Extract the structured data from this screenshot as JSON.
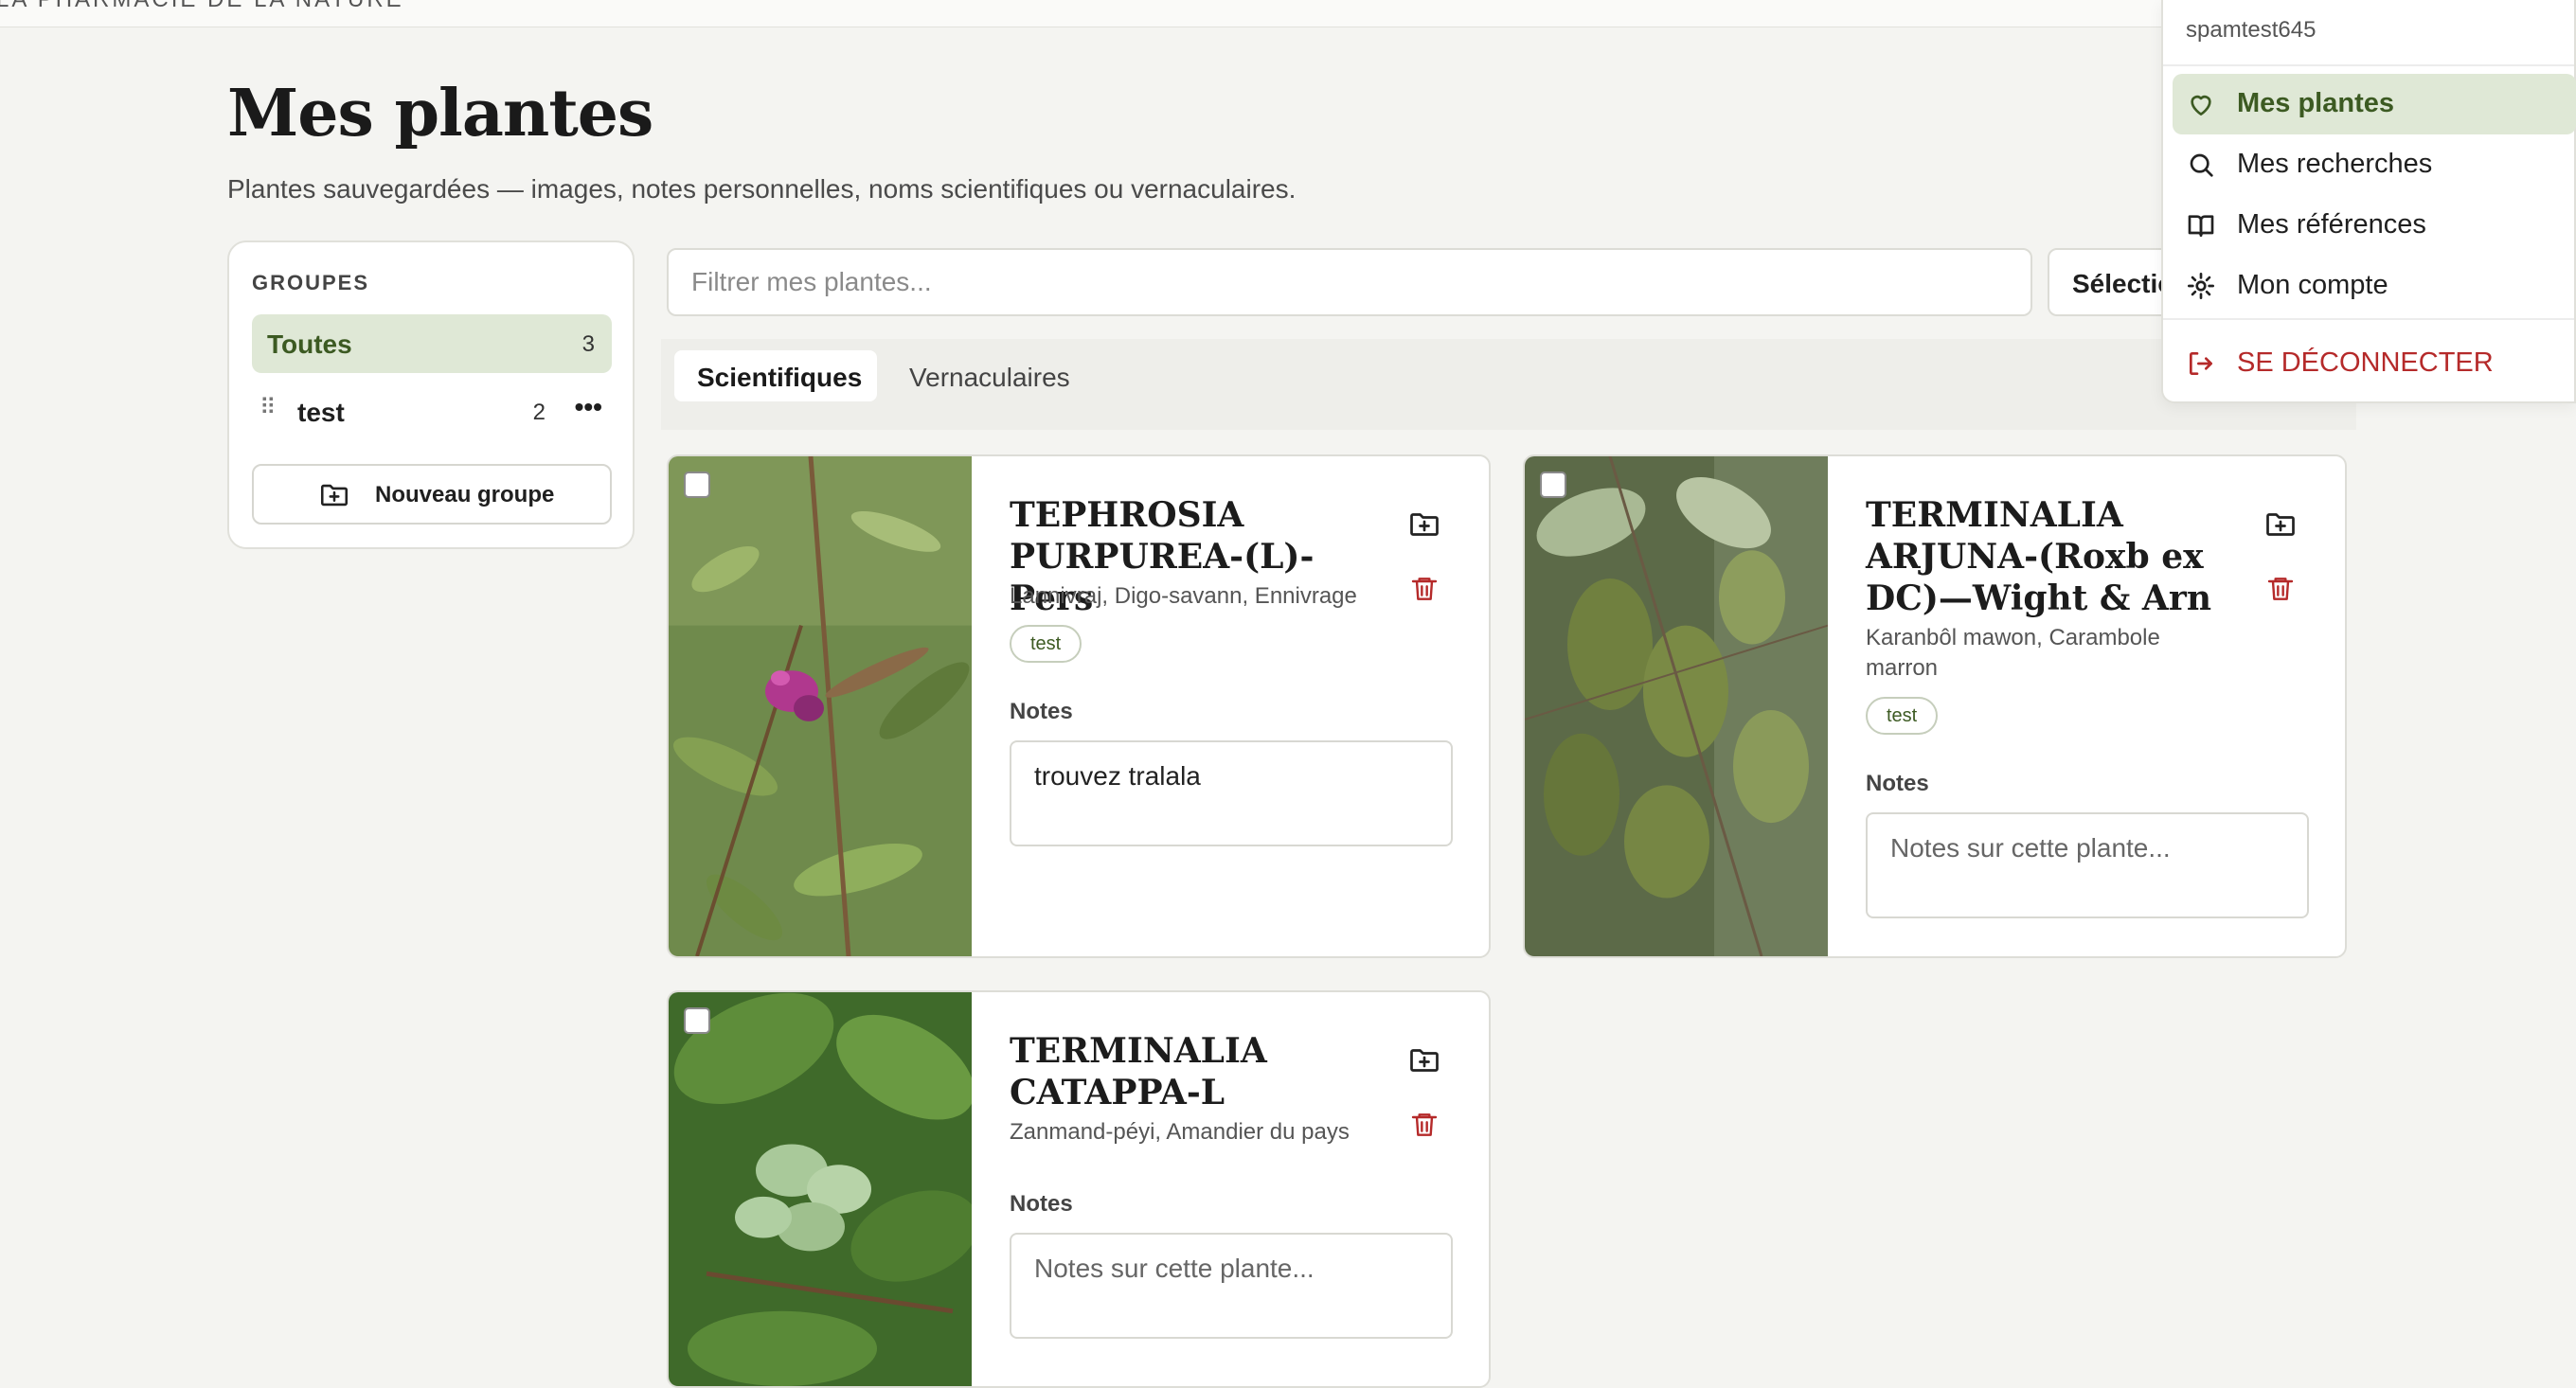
{
  "header": {
    "brand": "LA PHARMACIE DE LA NATURE"
  },
  "page": {
    "title": "Mes plantes",
    "subtitle": "Plantes sauvegardées — images, notes personnelles, noms scientifiques ou vernaculaires."
  },
  "groups": {
    "heading": "GROUPES",
    "items": [
      {
        "label": "Toutes",
        "count": "3"
      },
      {
        "label": "test",
        "count": "2"
      }
    ],
    "new_group_label": "Nouveau groupe"
  },
  "filter": {
    "placeholder": "Filtrer mes plantes..."
  },
  "select_button": {
    "label": "Sélectionner"
  },
  "tabs": [
    {
      "label": "Scientifiques"
    },
    {
      "label": "Vernaculaires"
    }
  ],
  "plants": [
    {
      "name": "TEPHROSIA PURPUREA-(L)-Pers",
      "vernacular": "Lannivraj, Digo-savann, Ennivrage",
      "tag": "test",
      "notes_label": "Notes",
      "notes_value": "trouvez tralala",
      "notes_placeholder": "Notes sur cette plante..."
    },
    {
      "name": "TERMINALIA ARJUNA-(Roxb ex DC)—Wight & Arn",
      "vernacular": "Karanbôl mawon, Carambole marron",
      "tag": "test",
      "notes_label": "Notes",
      "notes_value": "",
      "notes_placeholder": "Notes sur cette plante..."
    },
    {
      "name": "TERMINALIA CATAPPA-L",
      "vernacular": "Zanmand-péyi, Amandier du pays",
      "notes_label": "Notes",
      "notes_value": "",
      "notes_placeholder": "Notes sur cette plante..."
    }
  ],
  "user_menu": {
    "username": "spamtest645",
    "items": [
      {
        "label": "Mes plantes",
        "icon": "heart-icon",
        "active": true
      },
      {
        "label": "Mes recherches",
        "icon": "search-icon"
      },
      {
        "label": "Mes références",
        "icon": "book-icon"
      },
      {
        "label": "Mon compte",
        "icon": "gear-icon"
      }
    ],
    "logout_label": "SE DÉCONNECTER",
    "logout_icon": "logout-icon"
  },
  "colors": {
    "accent": "#3c5a22",
    "accent_bg": "#dfe8d6",
    "danger": "#b52a2a",
    "background": "#f4f4f1"
  }
}
